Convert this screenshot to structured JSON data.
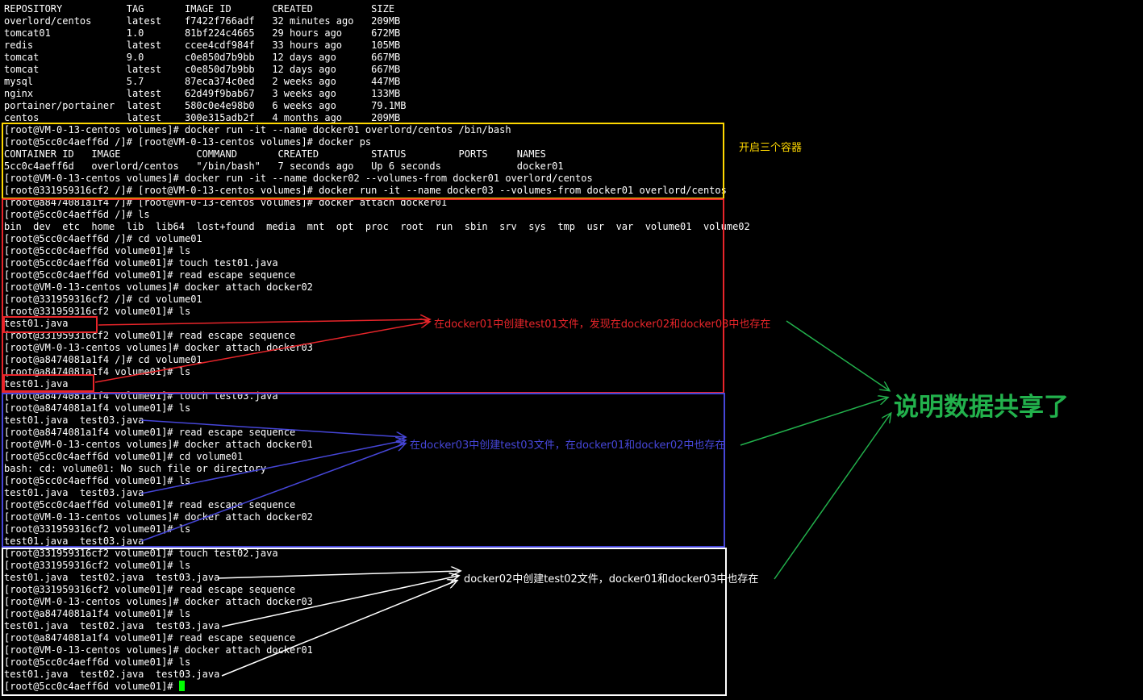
{
  "terminal": {
    "lines": [
      "REPOSITORY           TAG       IMAGE ID       CREATED          SIZE",
      "overlord/centos      latest    f7422f766adf   32 minutes ago   209MB",
      "tomcat01             1.0       81bf224c4665   29 hours ago     672MB",
      "redis                latest    ccee4cdf984f   33 hours ago     105MB",
      "tomcat               9.0       c0e850d7b9bb   12 days ago      667MB",
      "tomcat               latest    c0e850d7b9bb   12 days ago      667MB",
      "mysql                5.7       87eca374c0ed   2 weeks ago      447MB",
      "nginx                latest    62d49f9bab67   3 weeks ago      133MB",
      "portainer/portainer  latest    580c0e4e98b0   6 weeks ago      79.1MB",
      "centos               latest    300e315adb2f   4 months ago     209MB",
      "[root@VM-0-13-centos volumes]# docker run -it --name docker01 overlord/centos /bin/bash",
      "[root@5cc0c4aeff6d /]# [root@VM-0-13-centos volumes]# docker ps",
      "CONTAINER ID   IMAGE             COMMAND       CREATED         STATUS         PORTS     NAMES",
      "5cc0c4aeff6d   overlord/centos   \"/bin/bash\"   7 seconds ago   Up 6 seconds             docker01",
      "[root@VM-0-13-centos volumes]# docker run -it --name docker02 --volumes-from docker01 overlord/centos",
      "[root@331959316cf2 /]# [root@VM-0-13-centos volumes]# docker run -it --name docker03 --volumes-from docker01 overlord/centos",
      "[root@a8474081a1f4 /]# [root@VM-0-13-centos volumes]# docker attach docker01",
      "[root@5cc0c4aeff6d /]# ls",
      "bin  dev  etc  home  lib  lib64  lost+found  media  mnt  opt  proc  root  run  sbin  srv  sys  tmp  usr  var  volume01  volume02",
      "[root@5cc0c4aeff6d /]# cd volume01",
      "[root@5cc0c4aeff6d volume01]# ls",
      "[root@5cc0c4aeff6d volume01]# touch test01.java",
      "[root@5cc0c4aeff6d volume01]# read escape sequence",
      "[root@VM-0-13-centos volumes]# docker attach docker02",
      "[root@331959316cf2 /]# cd volume01",
      "[root@331959316cf2 volume01]# ls",
      "test01.java",
      "[root@331959316cf2 volume01]# read escape sequence",
      "[root@VM-0-13-centos volumes]# docker attach docker03",
      "[root@a8474081a1f4 /]# cd volume01",
      "[root@a8474081a1f4 volume01]# ls",
      "test01.java",
      "[root@a8474081a1f4 volume01]# touch test03.java",
      "[root@a8474081a1f4 volume01]# ls",
      "test01.java  test03.java",
      "[root@a8474081a1f4 volume01]# read escape sequence",
      "[root@VM-0-13-centos volumes]# docker attach docker01",
      "[root@5cc0c4aeff6d volume01]# cd volume01",
      "bash: cd: volume01: No such file or directory",
      "[root@5cc0c4aeff6d volume01]# ls",
      "test01.java  test03.java",
      "[root@5cc0c4aeff6d volume01]# read escape sequence",
      "[root@VM-0-13-centos volumes]# docker attach docker02",
      "[root@331959316cf2 volume01]# ls",
      "test01.java  test03.java",
      "[root@331959316cf2 volume01]# touch test02.java",
      "[root@331959316cf2 volume01]# ls",
      "test01.java  test02.java  test03.java",
      "[root@331959316cf2 volume01]# read escape sequence",
      "[root@VM-0-13-centos volumes]# docker attach docker03",
      "[root@a8474081a1f4 volume01]# ls",
      "test01.java  test02.java  test03.java",
      "[root@a8474081a1f4 volume01]# read escape sequence",
      "[root@VM-0-13-centos volumes]# docker attach docker01",
      "[root@5cc0c4aeff6d volume01]# ls",
      "test01.java  test02.java  test03.java",
      "[root@5cc0c4aeff6d volume01]# "
    ]
  },
  "annotations": {
    "start_containers": "开启三个容器",
    "docker01_note": "在docker01中创建test01文件，发现在docker02和docker03中也存在",
    "docker03_note": "在docker03中创建test03文件，在docker01和docker02中也存在",
    "docker02_note": "docker02中创建test02文件，docker01和docker03中也存在",
    "conclusion": "说明数据共享了"
  },
  "colors": {
    "background": "#000000",
    "text": "#ffffff",
    "cursor": "#00ff00",
    "yellow": "#ffd800",
    "red": "#e8252a",
    "blue": "#4646d8",
    "white": "#ffffff",
    "green": "#22b14c"
  }
}
